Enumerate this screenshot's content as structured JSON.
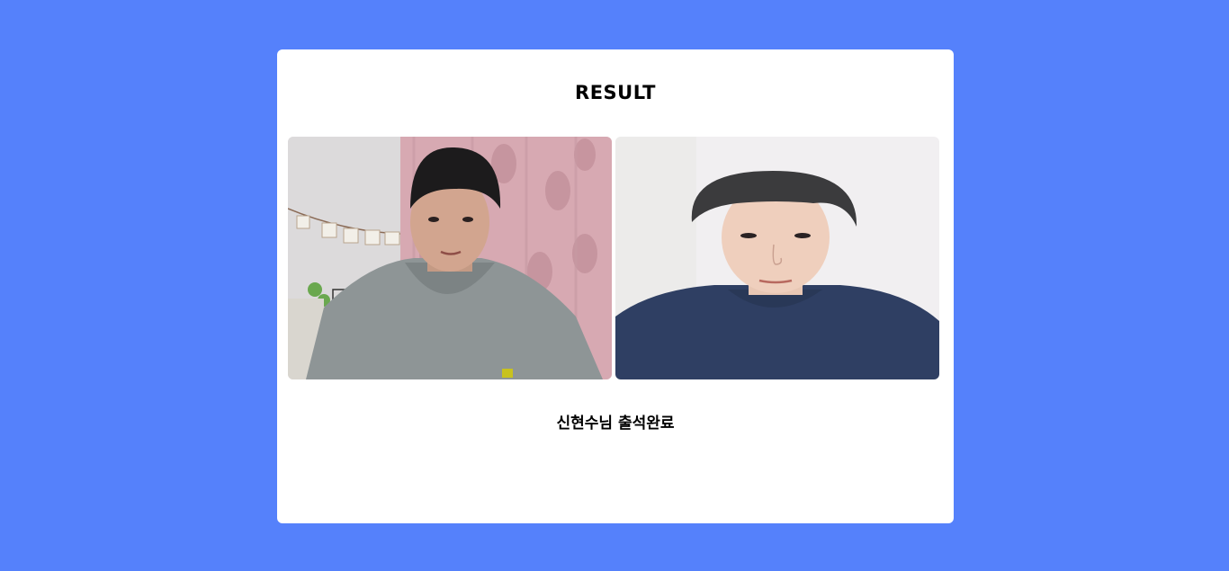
{
  "result": {
    "title": "RESULT",
    "message": "신현수님 출석완료"
  },
  "photos": [
    {
      "name": "captured-photo",
      "description_icon": "webcam-capture-photo"
    },
    {
      "name": "reference-photo",
      "description_icon": "registered-profile-photo"
    }
  ],
  "colors": {
    "background": "#5581fb",
    "card": "#ffffff"
  }
}
